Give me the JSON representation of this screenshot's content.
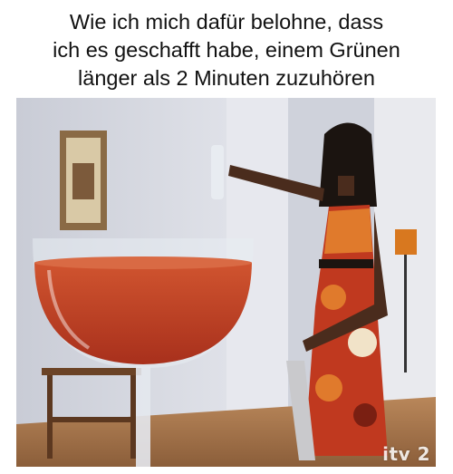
{
  "caption": {
    "lines": [
      "Wie ich mich dafür belohne, dass",
      "ich es geschafft habe, einem Grünen",
      "länger als 2 Minuten zuzuhören"
    ]
  },
  "photo": {
    "watermark": "itv 2"
  },
  "colors": {
    "wine": "#c4452a",
    "wall": "#d8dbe4",
    "dress_red": "#c0391f",
    "dress_orange": "#e07a2c"
  }
}
